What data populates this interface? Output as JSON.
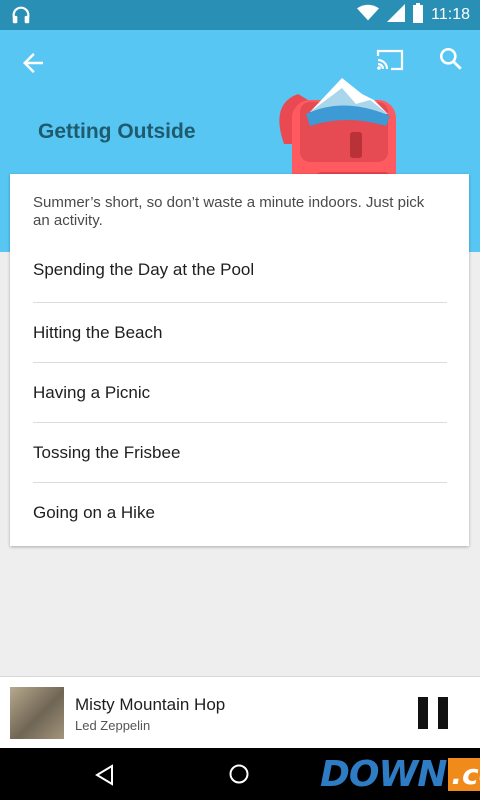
{
  "status_bar": {
    "time": "11:18",
    "icons": [
      "headphones-icon",
      "wifi-icon",
      "signal-icon",
      "battery-icon"
    ]
  },
  "header": {
    "title": "Getting Outside",
    "icons": [
      "back-arrow-icon",
      "cast-icon",
      "search-icon",
      "backpack-illustration"
    ],
    "background": "#57c6f3"
  },
  "card": {
    "intro": "Summer’s short, so don’t waste a minute indoors. Just pick an activity.",
    "items": [
      {
        "label": "Spending the Day at the Pool"
      },
      {
        "label": "Hitting the Beach"
      },
      {
        "label": "Having a Picnic"
      },
      {
        "label": "Tossing the Frisbee"
      },
      {
        "label": "Going on a Hike"
      }
    ]
  },
  "player": {
    "track": "Misty Mountain Hop",
    "artist": "Led Zeppelin",
    "icons": [
      "album-art",
      "pause-icon"
    ]
  },
  "nav_bar": {
    "icons": [
      "back-nav-icon",
      "home-nav-icon"
    ]
  },
  "watermark": {
    "text_main": "DOWN",
    "text_suffix": ".cc"
  },
  "colors": {
    "status_bar": "#2a8fb4",
    "header_bg": "#57c6f3",
    "title_text": "#1f5b6e",
    "page_bg": "#eeeeee"
  }
}
